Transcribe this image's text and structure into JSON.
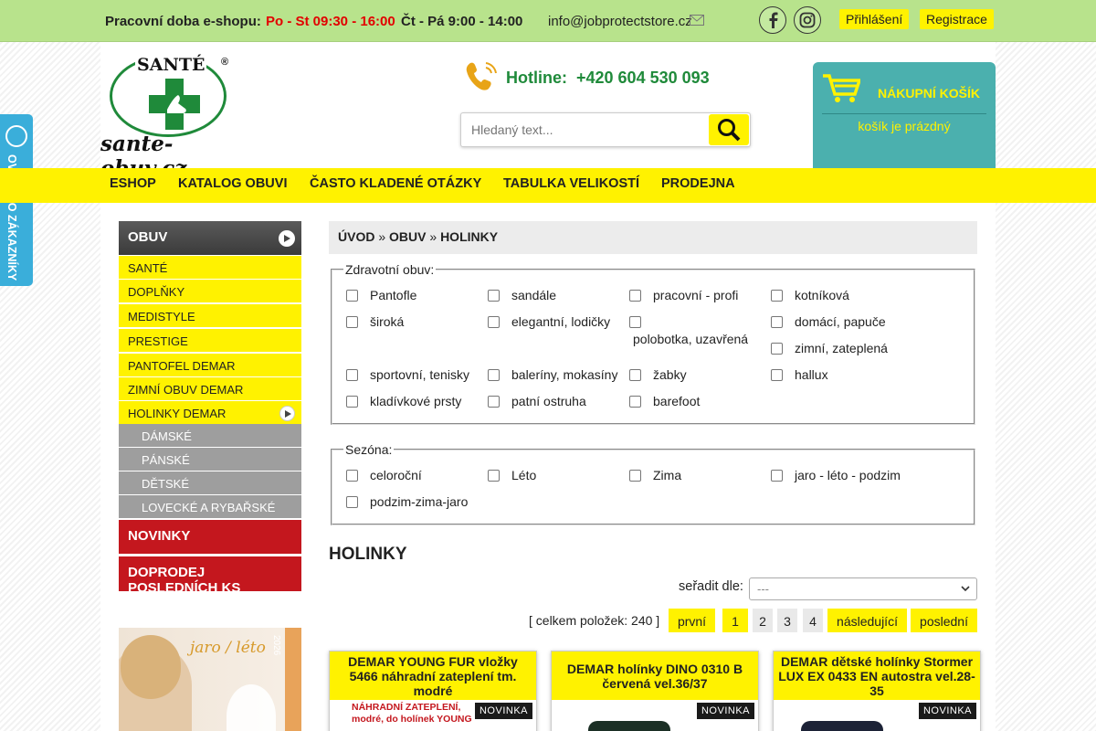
{
  "topbar": {
    "hours_label": "Pracovní doba e-shopu:",
    "hours_mon_wed": "Po - St 09:30 - 16:00",
    "hours_thu_fri": "Čt - Pá 9:00 - 14:00",
    "email": "info@jobprotectstore.cz",
    "login": "Přihlášení",
    "register": "Registrace"
  },
  "logo": {
    "brand": "SANTÉ",
    "site": "sante-obuv.cz"
  },
  "hotline": {
    "label": "Hotline:",
    "phone": "+420 604 530 093"
  },
  "search": {
    "placeholder": "Hledaný text..."
  },
  "cart": {
    "title": "NÁKUPNÍ KOŠÍK",
    "status": "košík je prázdný"
  },
  "badge": {
    "text": "OVĚŘENO ZÁKAZNÍKY"
  },
  "nav": [
    "ESHOP",
    "KATALOG OBUVI",
    "ČASTO KLADENÉ OTÁZKY",
    "TABULKA VELIKOSTÍ",
    "PRODEJNA"
  ],
  "sidebar": {
    "head": "OBUV",
    "items": [
      "SANTÉ",
      "DOPLŇKY",
      "MEDISTYLE",
      "PRESTIGE",
      "PANTOFEL DEMAR",
      "ZIMNÍ OBUV DEMAR",
      "HOLINKY DEMAR"
    ],
    "subitems": [
      "DÁMSKÉ",
      "PÁNSKÉ",
      "DĚTSKÉ",
      "LOVECKÉ A RYBAŘSKÉ"
    ],
    "news": "NOVINKY",
    "sale": "DOPRODEJ POSLEDNÍCH KS",
    "banner_text": "jaro / léto",
    "banner_year": "2026"
  },
  "breadcrumb": {
    "home": "ÚVOD",
    "sep": "»",
    "cat": "OBUV",
    "current": "HOLINKY"
  },
  "filters": {
    "health_legend": "Zdravotní obuv:",
    "health": [
      "Pantofle",
      "sandále",
      "pracovní - profi",
      "kotníková",
      "široká",
      "elegantní, lodičky",
      "polobotka, uzavřená",
      "domácí, papuče",
      "zimní, zateplená",
      "sportovní, tenisky",
      "baleríny, mokasíny",
      "žabky",
      "hallux",
      "kladívkové prsty",
      "patní ostruha",
      "barefoot"
    ],
    "season_legend": "Sezóna:",
    "season": [
      "celoroční",
      "Léto",
      "Zima",
      "jaro - léto - podzim",
      "podzim-zima-jaro"
    ]
  },
  "main": {
    "title": "HOLINKY",
    "sort_label": "seřadit dle:",
    "sort_value": "---"
  },
  "pagination": {
    "total": "[ celkem položek: 240 ]",
    "first": "první",
    "pages": [
      "1",
      "2",
      "3",
      "4"
    ],
    "next": "následující",
    "last": "poslední"
  },
  "products": [
    {
      "name": "DEMAR YOUNG FUR vložky 5466 náhradní zateplení tm. modré",
      "badge": "NOVINKA",
      "img_text": "NÁHRADNÍ ZATEPLENÍ, modré, do holínek YOUNG"
    },
    {
      "name": "DEMAR holínky DINO 0310 B červená vel.36/37",
      "badge": "NOVINKA"
    },
    {
      "name": "DEMAR dětské holínky Stormer LUX EX 0433 EN autostra vel.28-35",
      "badge": "NOVINKA"
    }
  ]
}
